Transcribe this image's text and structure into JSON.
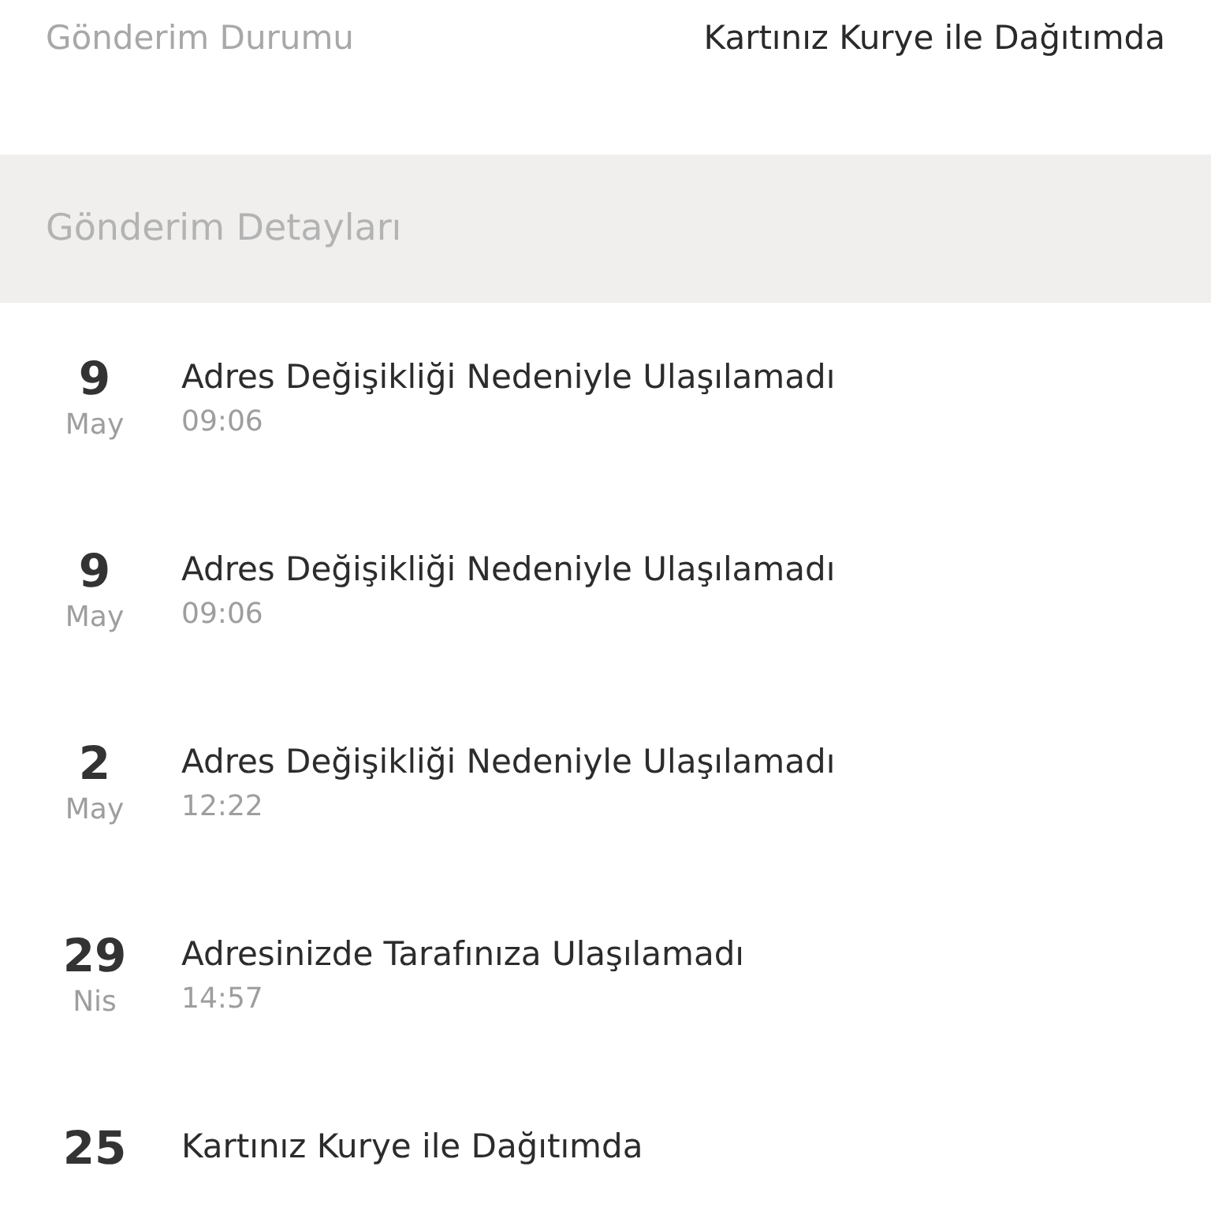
{
  "status": {
    "label": "Gönderim Durumu",
    "value": "Kartınız Kurye ile Dağıtımda"
  },
  "details_header": "Gönderim Detayları",
  "events": [
    {
      "day": "9",
      "month": "May",
      "title": "Adres Değişikliği Nedeniyle Ulaşılamadı",
      "time": "09:06"
    },
    {
      "day": "9",
      "month": "May",
      "title": "Adres Değişikliği Nedeniyle Ulaşılamadı",
      "time": "09:06"
    },
    {
      "day": "2",
      "month": "May",
      "title": "Adres Değişikliği Nedeniyle Ulaşılamadı",
      "time": "12:22"
    },
    {
      "day": "29",
      "month": "Nis",
      "title": "Adresinizde Tarafınıza Ulaşılamadı",
      "time": "14:57"
    },
    {
      "day": "25",
      "title": "Kartınız Kurye ile Dağıtımda"
    }
  ]
}
